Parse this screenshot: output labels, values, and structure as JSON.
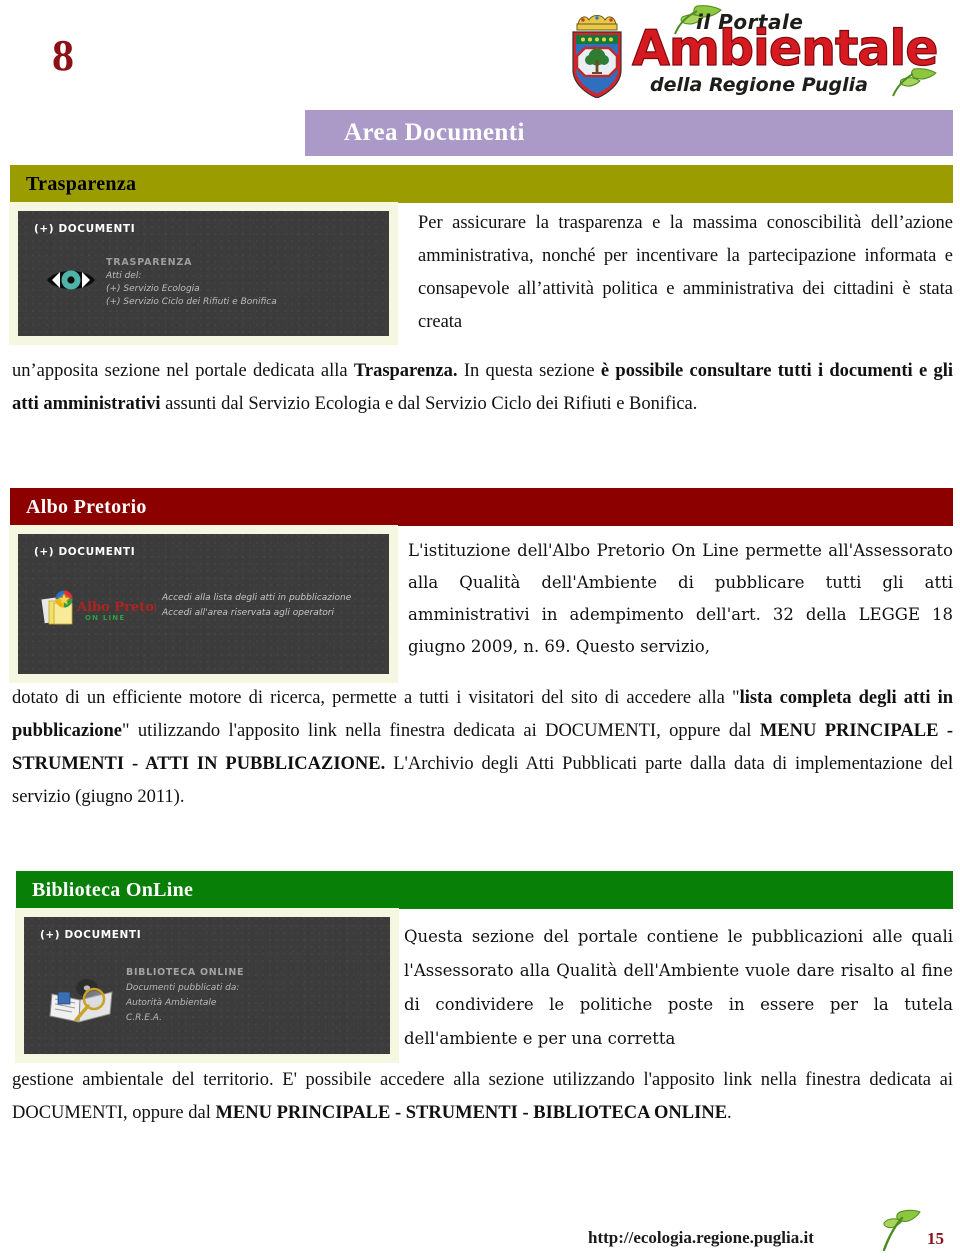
{
  "page": {
    "number_top": "8",
    "title": "Area Documenti"
  },
  "logo": {
    "line1": "il Portale",
    "line2": "Ambientale",
    "line3": "della Regione Puglia",
    "crest_name": "puglia-coat-of-arms",
    "colors": {
      "wordmark": "#d71920",
      "leaf": "#7ab648"
    }
  },
  "sections": [
    {
      "id": "trasparenza",
      "bar_label": "Trasparenza",
      "bar_color": "#9b9c00",
      "bar_text_color": "#000000"
    },
    {
      "id": "albo-pretorio",
      "bar_label": "Albo Pretorio",
      "bar_color": "#8c0000",
      "bar_text_color": "#ffffff"
    },
    {
      "id": "biblioteca-online",
      "bar_label": "Biblioteca OnLine",
      "bar_color": "#088008",
      "bar_text_color": "#ffffff"
    }
  ],
  "shots": {
    "trasparenza": {
      "panel_label": "(+) DOCUMENTI",
      "icon": "eye-icon",
      "heading": "TRASPARENZA",
      "lines": [
        "Atti del:",
        "(+) Servizio Ecologia",
        "(+) Servizio Ciclo dei Rifiuti e Bonifica"
      ]
    },
    "albo": {
      "panel_label": "(+) DOCUMENTI",
      "icon": "albo-pretorio-logo",
      "logo_title": "Albo Pretorio",
      "logo_subtitle": "ON LINE",
      "lines": [
        "Accedi alla lista degli atti in pubblicazione",
        "Accedi all'area riservata agli operatori"
      ]
    },
    "biblioteca": {
      "panel_label": "(+) DOCUMENTI",
      "icon": "book-magnifier-icon",
      "heading": "BIBLIOTECA ONLINE",
      "lines": [
        "Documenti pubblicati da:",
        "Autorità Ambientale",
        "C.R.E.A."
      ]
    }
  },
  "body": {
    "trasparenza_top": "Per assicurare la trasparenza e la massima conoscibilità dell’azione amministrativa, nonché per incentivare la partecipazione informata e consapevole all’attività politica e amministrativa dei cittadini è stata creata",
    "trasparenza_rest_1": "un’apposita sezione nel portale dedicata alla ",
    "trasparenza_rest_b1": "Trasparenza.",
    "trasparenza_rest_2": " In questa sezione ",
    "trasparenza_rest_b2": "è possibile consultare tutti i documenti e gli atti amministrativi",
    "trasparenza_rest_3": " assunti dal Servizio Ecologia e dal Servizio Ciclo dei Rifiuti e Bonifica.",
    "albo_top": "L'istituzione dell'Albo Pretorio On Line permette all'Assessorato alla Qualità dell'Ambiente di pubblicare tutti gli atti amministrativi in adempimento dell'art. 32 della LEGGE 18 giugno 2009, n. 69. Questo servizio,",
    "albo_rest_1": "dotato di un efficiente motore di ricerca, permette a tutti i visitatori del sito di accedere alla \"",
    "albo_rest_b1": "lista completa degli atti in pubblicazione",
    "albo_rest_2": "\" utilizzando l'apposito link nella finestra dedicata ai DOCUMENTI, oppure dal ",
    "albo_rest_b2": "MENU PRINCIPALE - STRUMENTI - ATTI IN PUBBLICAZIONE.",
    "albo_rest_3": " L'Archivio degli Atti Pubblicati parte dalla data di implementazione del servizio (giugno 2011).",
    "biblioteca_top": "Questa sezione del portale contiene le pubblicazioni alle quali l'Assessorato alla Qualità dell'Ambiente vuole dare risalto al fine di condividere le politiche poste in essere per la tutela dell'ambiente e per una corretta",
    "biblioteca_rest_1": "gestione ambientale del territorio.  E' possibile accedere alla sezione utilizzando l'apposito link nella finestra dedicata ai DOCUMENTI, oppure dal ",
    "biblioteca_rest_b1": "MENU PRINCIPALE - STRUMENTI - BIBLIOTECA ONLINE",
    "biblioteca_rest_2": "."
  },
  "footer": {
    "url": "http://ecologia.regione.puglia.it",
    "sprout_icon": "leaf-sprout-icon",
    "page_number": "15"
  }
}
